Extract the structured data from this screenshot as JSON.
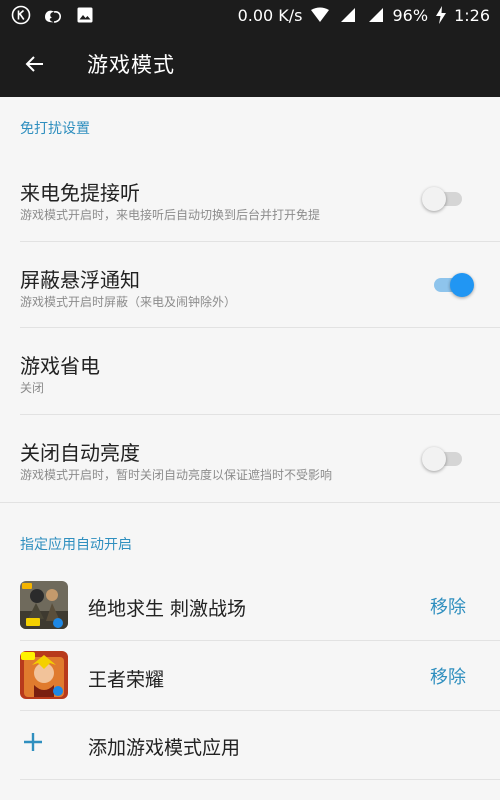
{
  "statusbar": {
    "speed": "0.00 K/s",
    "battery": "96%",
    "time": "1:26",
    "icons": [
      "k-logo-icon",
      "uc-browser-icon",
      "image-icon",
      "wifi-icon",
      "signal-icon",
      "signal-icon-2",
      "battery-charging-icon"
    ]
  },
  "appbar": {
    "title": "游戏模式"
  },
  "section_dnd": {
    "header": "免打扰设置",
    "items": [
      {
        "title": "来电免提接听",
        "subtitle": "游戏模式开启时，来电接听后自动切换到后台并打开免提",
        "switch": false
      },
      {
        "title": "屏蔽悬浮通知",
        "subtitle": "游戏模式开启时屏蔽（来电及闹钟除外）",
        "switch": true
      },
      {
        "title": "游戏省电",
        "subtitle": "关闭"
      },
      {
        "title": "关闭自动亮度",
        "subtitle": "游戏模式开启时，暂时关闭自动亮度以保证遮挡时不受影响",
        "switch": false
      }
    ]
  },
  "section_apps": {
    "header": "指定应用自动开启",
    "apps": [
      {
        "name": "绝地求生 刺激战场",
        "action": "移除"
      },
      {
        "name": "王者荣耀",
        "action": "移除"
      }
    ],
    "add_label": "添加游戏模式应用"
  },
  "colors": {
    "accent": "#2f8fbf",
    "switch_on": "#2196f3",
    "bar_bg": "#1c1c1c",
    "page_bg": "#f6f6f6"
  }
}
